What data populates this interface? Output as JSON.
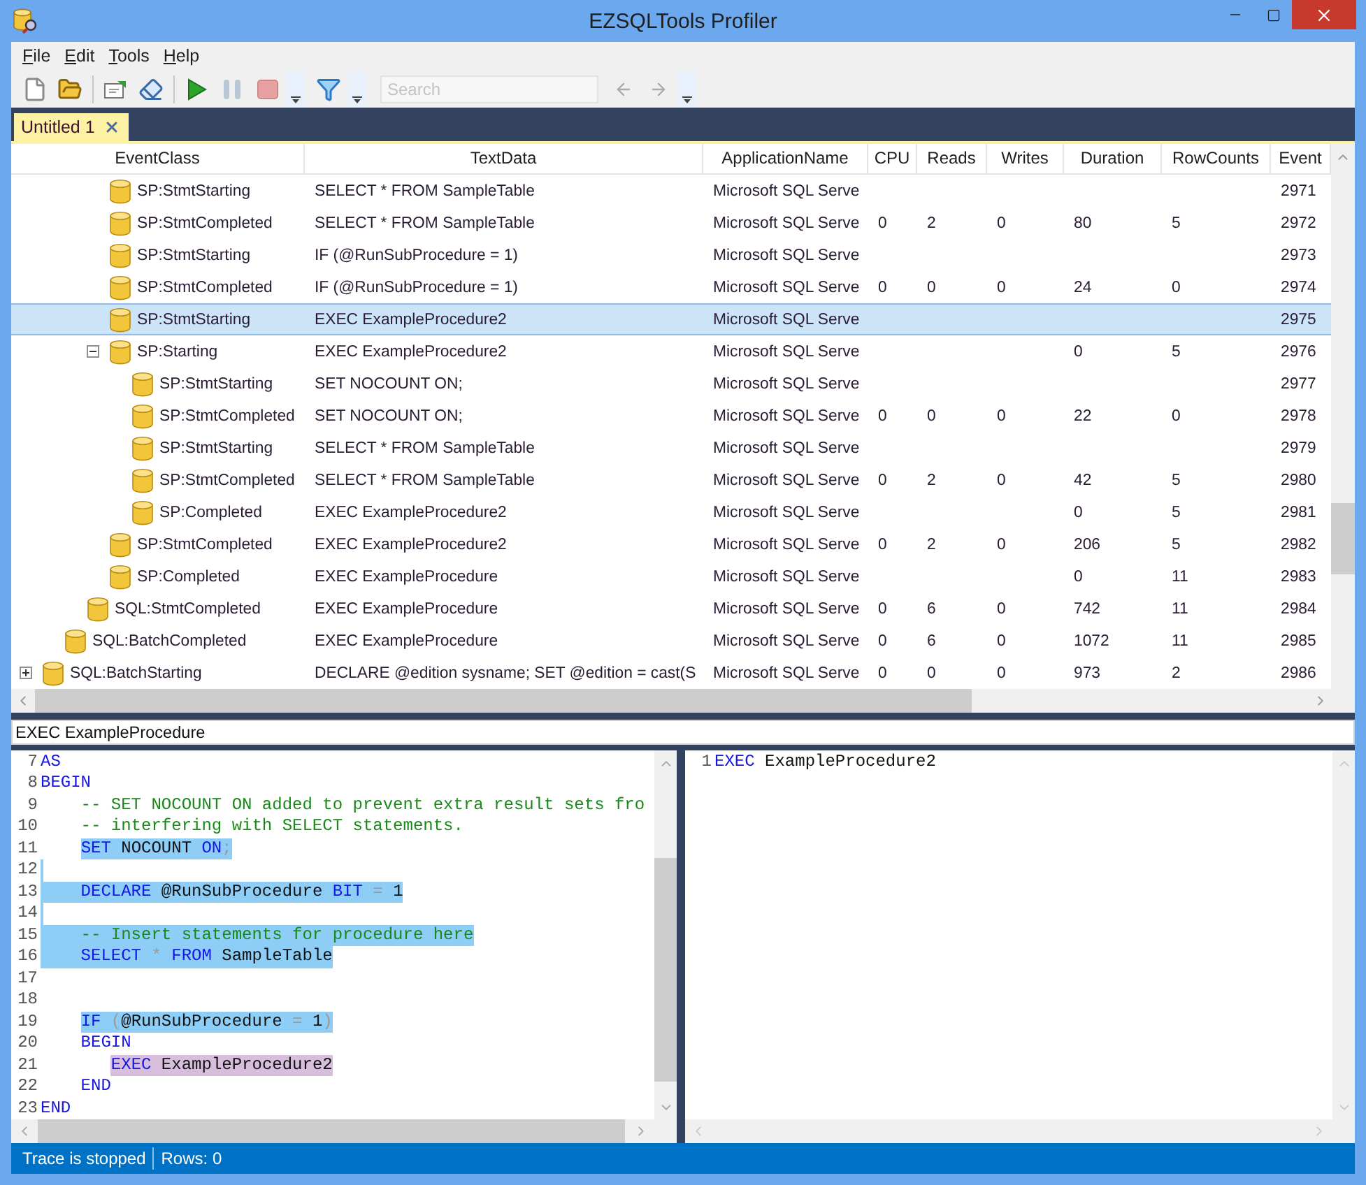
{
  "window": {
    "title": "EZSQLTools Profiler"
  },
  "menu": [
    "File",
    "Edit",
    "Tools",
    "Help"
  ],
  "toolbar": {
    "search": {
      "placeholder": "Search"
    }
  },
  "tabs": [
    {
      "label": "Untitled 1",
      "selected": true
    }
  ],
  "grid": {
    "columns": [
      "EventClass",
      "TextData",
      "ApplicationName",
      "CPU",
      "Reads",
      "Writes",
      "Duration",
      "RowCounts",
      "Event"
    ],
    "rows": [
      {
        "children": [
          {
            "children": [
              {
                "children": [
                  {
                    "event_class": "SP:StmtStarting",
                    "text_data": "SELECT * FROM SampleTable",
                    "application_name": "Microsoft SQL Serve",
                    "event": "2971",
                    "selected": false
                  },
                  {
                    "event_class": "SP:StmtCompleted",
                    "text_data": "SELECT * FROM SampleTable",
                    "application_name": "Microsoft SQL Serve",
                    "cpu": "0",
                    "reads": "2",
                    "writes": "0",
                    "duration": "80",
                    "row_counts": "5",
                    "event": "2972",
                    "selected": false
                  },
                  {
                    "event_class": "SP:StmtStarting",
                    "text_data": "IF (@RunSubProcedure = 1)",
                    "application_name": "Microsoft SQL Serve",
                    "event": "2973",
                    "selected": false
                  },
                  {
                    "event_class": "SP:StmtCompleted",
                    "text_data": "IF (@RunSubProcedure = 1)",
                    "application_name": "Microsoft SQL Serve",
                    "cpu": "0",
                    "reads": "0",
                    "writes": "0",
                    "duration": "24",
                    "row_counts": "0",
                    "event": "2974",
                    "selected": false
                  },
                  {
                    "event_class": "SP:StmtStarting",
                    "text_data": "EXEC ExampleProcedure2",
                    "application_name": "Microsoft SQL Serve",
                    "event": "2975",
                    "selected": true
                  },
                  {
                    "event_class": "SP:Starting",
                    "text_data": "EXEC ExampleProcedure2",
                    "application_name": "Microsoft SQL Serve",
                    "duration": "0",
                    "row_counts": "5",
                    "event": "2976",
                    "selected": false,
                    "expanded": true,
                    "children": [
                      {
                        "event_class": "SP:StmtStarting",
                        "text_data": "SET NOCOUNT ON;",
                        "application_name": "Microsoft SQL Serve",
                        "event": "2977",
                        "selected": false
                      },
                      {
                        "event_class": "SP:StmtCompleted",
                        "text_data": "SET NOCOUNT ON;",
                        "application_name": "Microsoft SQL Serve",
                        "cpu": "0",
                        "reads": "0",
                        "writes": "0",
                        "duration": "22",
                        "row_counts": "0",
                        "event": "2978",
                        "selected": false
                      },
                      {
                        "event_class": "SP:StmtStarting",
                        "text_data": "SELECT * FROM SampleTable",
                        "application_name": "Microsoft SQL Serve",
                        "event": "2979",
                        "selected": false
                      },
                      {
                        "event_class": "SP:StmtCompleted",
                        "text_data": "SELECT * FROM SampleTable",
                        "application_name": "Microsoft SQL Serve",
                        "cpu": "0",
                        "reads": "2",
                        "writes": "0",
                        "duration": "42",
                        "row_counts": "5",
                        "event": "2980",
                        "selected": false
                      },
                      {
                        "event_class": "SP:Completed",
                        "text_data": "EXEC ExampleProcedure2",
                        "application_name": "Microsoft SQL Serve",
                        "duration": "0",
                        "row_counts": "5",
                        "event": "2981",
                        "selected": false
                      }
                    ]
                  },
                  {
                    "event_class": "SP:StmtCompleted",
                    "text_data": "EXEC ExampleProcedure2",
                    "application_name": "Microsoft SQL Serve",
                    "cpu": "0",
                    "reads": "2",
                    "writes": "0",
                    "duration": "206",
                    "row_counts": "5",
                    "event": "2982",
                    "selected": false
                  },
                  {
                    "event_class": "SP:Completed",
                    "text_data": "EXEC ExampleProcedure",
                    "application_name": "Microsoft SQL Serve",
                    "duration": "0",
                    "row_counts": "11",
                    "event": "2983",
                    "selected": false
                  }
                ]
              },
              {
                "event_class": "SQL:StmtCompleted",
                "text_data": "EXEC ExampleProcedure",
                "application_name": "Microsoft SQL Serve",
                "cpu": "0",
                "reads": "6",
                "writes": "0",
                "duration": "742",
                "row_counts": "11",
                "event": "2984",
                "selected": false
              }
            ]
          },
          {
            "event_class": "SQL:BatchCompleted",
            "text_data": "EXEC ExampleProcedure",
            "application_name": "Microsoft SQL Serve",
            "cpu": "0",
            "reads": "6",
            "writes": "0",
            "duration": "1072",
            "row_counts": "11",
            "event": "2985",
            "selected": false
          }
        ]
      },
      {
        "event_class": "SQL:BatchStarting",
        "text_data": "DECLARE @edition sysname; SET @edition = cast(S",
        "application_name": "Microsoft SQL Serve",
        "cpu": "0",
        "reads": "0",
        "writes": "0",
        "duration": "973",
        "row_counts": "2",
        "event": "2986",
        "selected": false,
        "expanded": false
      }
    ]
  },
  "detail_field": {
    "value": "EXEC ExampleProcedure"
  },
  "editor_left": {
    "lines": [
      {
        "number": "7",
        "selected": false,
        "segments": [
          {
            "text": "AS",
            "kind": "keyword"
          }
        ]
      },
      {
        "number": "8",
        "selected": false,
        "segments": [
          {
            "text": "BEGIN",
            "kind": "keyword"
          }
        ]
      },
      {
        "number": "9",
        "selected": false,
        "segments": [
          {
            "text": "    -- SET NOCOUNT ON added to prevent extra result sets fro",
            "kind": "comment"
          }
        ]
      },
      {
        "number": "10",
        "selected": false,
        "segments": [
          {
            "text": "    -- interfering with SELECT statements.",
            "kind": "comment"
          }
        ]
      },
      {
        "number": "11",
        "selected": false,
        "segments": [
          {
            "text": "    SET",
            "kind": "keyword",
            "selected": true
          },
          {
            "text": " NOCOUNT ",
            "kind": "plain",
            "selected": true
          },
          {
            "text": "ON",
            "kind": "keyword",
            "selected": true
          },
          {
            "text": ";",
            "kind": "operator",
            "selected": true
          }
        ]
      },
      {
        "number": "12",
        "selected": true
      },
      {
        "number": "13",
        "selected": true,
        "segments": [
          {
            "text": "    DECLARE",
            "kind": "keyword"
          },
          {
            "text": " @RunSubProcedure ",
            "kind": "plain"
          },
          {
            "text": "BIT",
            "kind": "keyword"
          },
          {
            "text": " = ",
            "kind": "operator"
          },
          {
            "text": "1",
            "kind": "plain"
          }
        ]
      },
      {
        "number": "14",
        "selected": true
      },
      {
        "number": "15",
        "selected": true,
        "segments": [
          {
            "text": "    -- Insert statements for procedure here",
            "kind": "comment"
          }
        ]
      },
      {
        "number": "16",
        "selected": true,
        "segments": [
          {
            "text": "    SELECT",
            "kind": "keyword"
          },
          {
            "text": " * ",
            "kind": "operator"
          },
          {
            "text": "FROM",
            "kind": "keyword"
          },
          {
            "text": " SampleTable",
            "kind": "plain"
          }
        ]
      },
      {
        "number": "17",
        "selected": false
      },
      {
        "number": "18",
        "selected": false
      },
      {
        "number": "19",
        "selected": false,
        "segments": [
          {
            "text": "    IF",
            "kind": "keyword",
            "selected": true
          },
          {
            "text": " (",
            "kind": "operator",
            "selected": true
          },
          {
            "text": "@RunSubProcedure",
            "kind": "plain",
            "selected": true
          },
          {
            "text": " = ",
            "kind": "operator",
            "selected": true
          },
          {
            "text": "1",
            "kind": "plain",
            "selected": true
          },
          {
            "text": ")",
            "kind": "operator",
            "selected": true
          }
        ]
      },
      {
        "number": "20",
        "selected": false,
        "segments": [
          {
            "text": "    BEGIN",
            "kind": "keyword"
          }
        ]
      },
      {
        "number": "21",
        "selected": false,
        "segments": [
          {
            "text": "       EXEC",
            "kind": "keyword",
            "matched": true
          },
          {
            "text": " ExampleProcedure2",
            "kind": "plain",
            "matched": true
          }
        ]
      },
      {
        "number": "22",
        "selected": false,
        "segments": [
          {
            "text": "    END",
            "kind": "keyword"
          }
        ]
      },
      {
        "number": "23",
        "selected": false,
        "segments": [
          {
            "text": "END",
            "kind": "keyword"
          }
        ]
      }
    ]
  },
  "editor_right": {
    "lines": [
      {
        "number": "1",
        "selected": false,
        "segments": [
          {
            "text": "EXEC",
            "kind": "keyword"
          },
          {
            "text": " ExampleProcedure2",
            "kind": "plain"
          }
        ]
      }
    ]
  },
  "status_bar": [
    "Trace is stopped",
    "Rows:  0"
  ]
}
